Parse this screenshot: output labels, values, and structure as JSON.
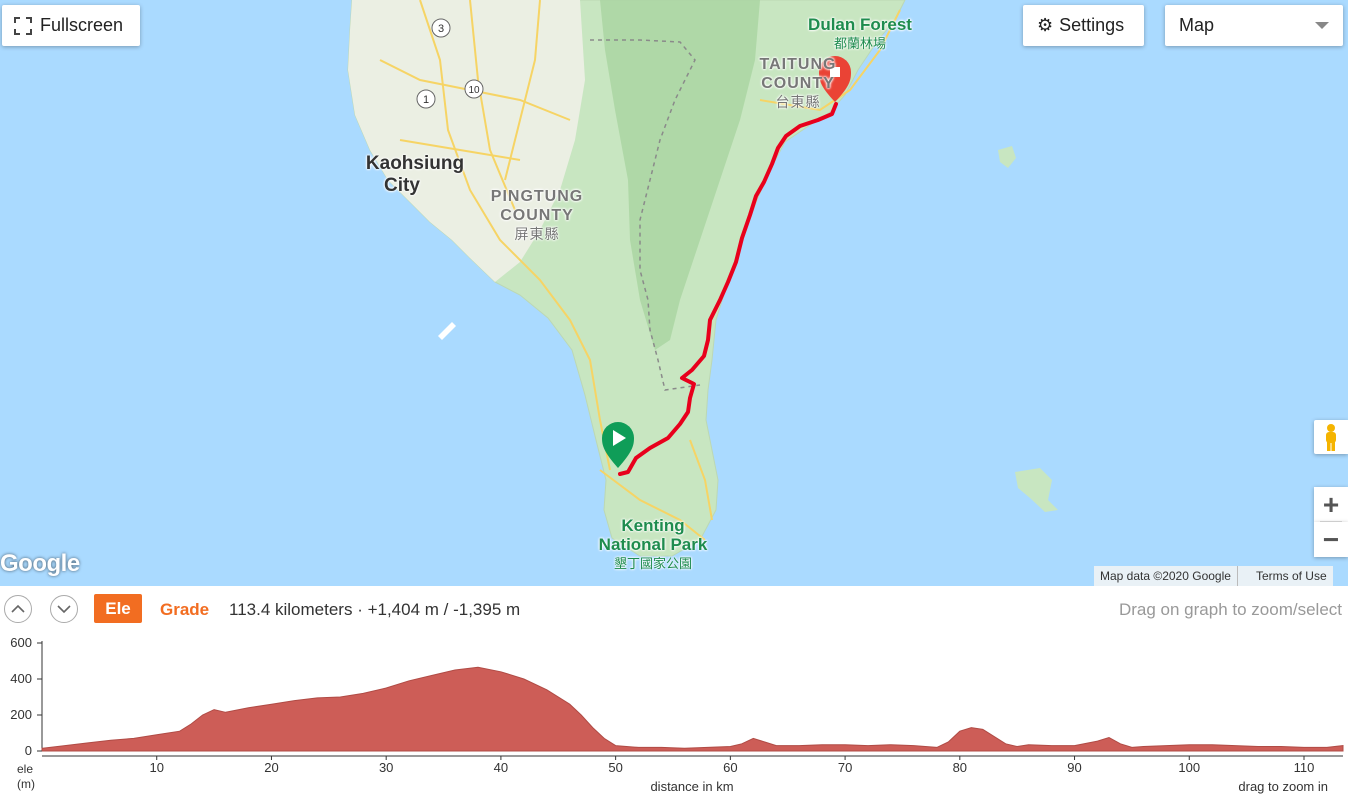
{
  "map": {
    "fullscreen_label": "Fullscreen",
    "settings_label": "Settings",
    "map_type": {
      "selected": "Map"
    },
    "zoom_in": "+",
    "zoom_out": "−",
    "google_logo": "Google",
    "attribution": {
      "data": "Map data ©2020 Google",
      "terms": "Terms of Use"
    },
    "places": {
      "kaohsiung_line1": "Kaohsiung",
      "kaohsiung_line2": "City",
      "pingtung_line1": "PINGTUNG",
      "pingtung_line2": "COUNTY",
      "pingtung_cjk": "屏東縣",
      "taitung_line1": "TAITUNG",
      "taitung_line2": "COUNTY",
      "taitung_cjk": "台東縣",
      "dulan_en": "Dulan Forest",
      "dulan_cjk": "都蘭林場",
      "kenting_line1": "Kenting",
      "kenting_line2": "National Park",
      "kenting_cjk": "墾丁國家公園"
    },
    "route_shields": [
      "3",
      "1",
      "10"
    ],
    "colors": {
      "route": "#e8001c",
      "start_marker": "#0f9d58",
      "end_marker": "#ea4335",
      "sea": "#aadaff",
      "land": "#c8e6c1"
    }
  },
  "panel": {
    "ele_tab": "Ele",
    "grade_tab": "Grade",
    "stats": "113.4 kilometers · +1,404 m / -1,395 m",
    "hint": "Drag on graph to zoom/select",
    "accent": "#f26d21"
  },
  "chart_data": {
    "type": "area",
    "xlabel": "distance in km",
    "ylabel_line1": "ele",
    "ylabel_line2": "(m)",
    "note": "drag to zoom in",
    "xlim": [
      0,
      113.4
    ],
    "ylim": [
      0,
      600
    ],
    "x_ticks": [
      10,
      20,
      30,
      40,
      50,
      60,
      70,
      80,
      90,
      100,
      110
    ],
    "y_ticks": [
      0,
      200,
      400,
      600
    ],
    "fill_color": "#cd5d57",
    "series": [
      {
        "x": [
          0,
          2,
          4,
          6,
          8,
          10,
          12,
          13,
          14,
          15,
          16,
          18,
          20,
          22,
          24,
          26,
          28,
          30,
          32,
          34,
          36,
          38,
          40,
          42,
          44,
          46,
          47,
          48,
          49,
          50,
          52,
          54,
          56,
          58,
          60,
          61,
          62,
          63,
          64,
          66,
          68,
          70,
          72,
          74,
          76,
          77,
          78,
          79,
          80,
          81,
          82,
          83,
          84,
          85,
          86,
          88,
          90,
          92,
          93,
          94,
          95,
          96,
          98,
          100,
          102,
          104,
          106,
          108,
          110,
          112,
          113.4
        ],
        "y": [
          15,
          30,
          45,
          60,
          70,
          90,
          110,
          150,
          200,
          230,
          215,
          240,
          260,
          280,
          295,
          300,
          320,
          350,
          390,
          420,
          450,
          465,
          440,
          400,
          340,
          260,
          200,
          130,
          70,
          30,
          20,
          20,
          15,
          20,
          25,
          40,
          70,
          50,
          30,
          30,
          35,
          35,
          30,
          35,
          30,
          25,
          20,
          50,
          110,
          130,
          120,
          80,
          40,
          25,
          35,
          30,
          30,
          55,
          75,
          40,
          20,
          25,
          30,
          35,
          35,
          30,
          25,
          25,
          20,
          20,
          30
        ]
      }
    ]
  }
}
